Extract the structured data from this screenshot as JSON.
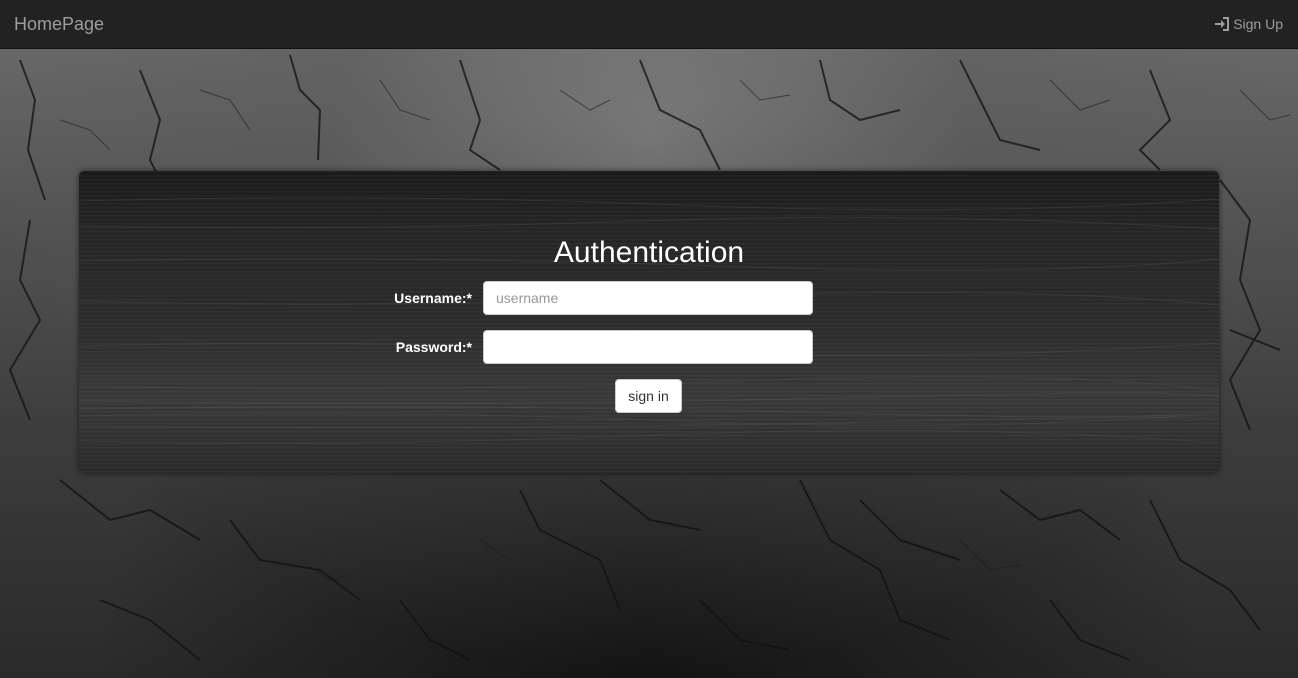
{
  "navbar": {
    "brand": "HomePage",
    "signup_label": "Sign Up",
    "signup_icon": "sign-in-icon"
  },
  "auth": {
    "title": "Authentication",
    "username_label": "Username:*",
    "username_placeholder": "username",
    "username_value": "",
    "password_label": "Password:*",
    "password_value": "",
    "submit_label": "sign in"
  },
  "colors": {
    "navbar_bg": "#222222",
    "navbar_text": "#9d9d9d",
    "title_text": "#ffffff"
  }
}
